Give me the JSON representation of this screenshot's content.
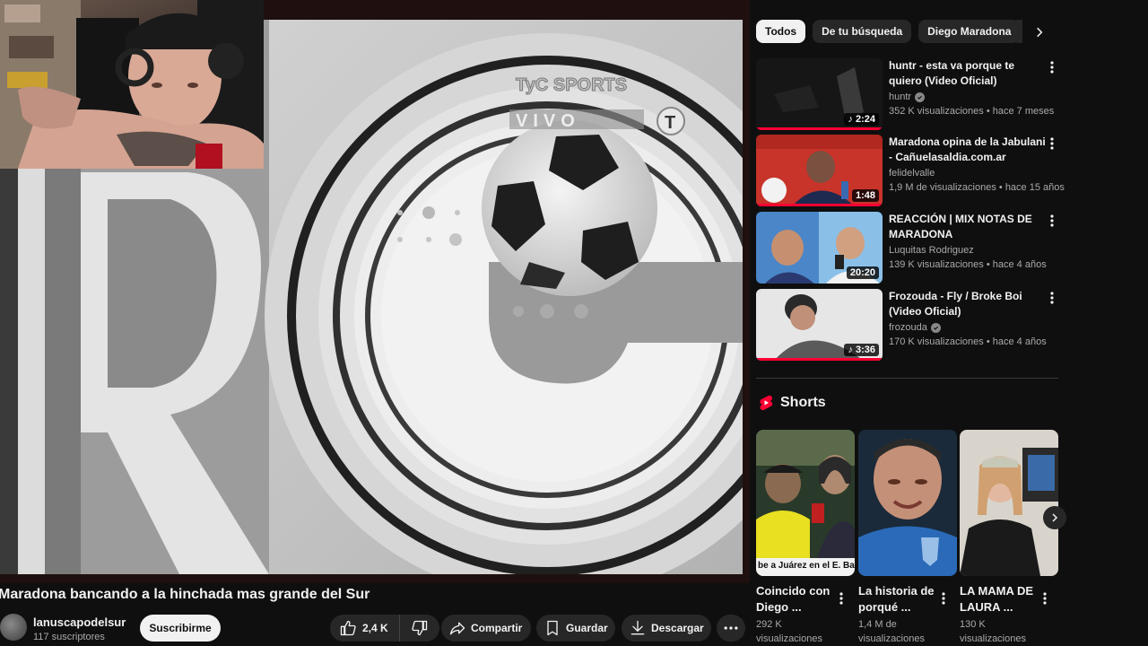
{
  "player": {
    "overlay_brand": "TyC SPORTS",
    "overlay_live": "VIVO",
    "overlay_badge": "T"
  },
  "video": {
    "title": "Maradona bancando a la hinchada mas grande del Sur",
    "channel": "lanuscapodelsur",
    "subscribers": "117 suscriptores",
    "subscribe_label": "Suscribirme",
    "likes": "2,4 K",
    "share_label": "Compartir",
    "save_label": "Guardar",
    "download_label": "Descargar"
  },
  "chips": [
    {
      "label": "Todos",
      "active": true
    },
    {
      "label": "De tu búsqueda",
      "active": false
    },
    {
      "label": "Diego Maradona",
      "active": false
    }
  ],
  "recommendations": [
    {
      "title": "huntr - esta va porque te quiero (Video Oficial)",
      "channel": "huntr",
      "verified": true,
      "views": "352 K visualizaciones",
      "age": "hace 7 meses",
      "duration": "2:24",
      "music": true,
      "progress": 1.0
    },
    {
      "title": "Maradona opina de la Jabulani - Cañuelasaldia.com.ar",
      "channel": "felidelvalle",
      "verified": false,
      "views": "1,9 M de visualizaciones",
      "age": "hace 15 años",
      "duration": "1:48",
      "music": false,
      "progress": 1.0
    },
    {
      "title": "REACCIÓN | MIX NOTAS DE MARADONA",
      "channel": "Luquitas Rodriguez",
      "verified": false,
      "views": "139 K visualizaciones",
      "age": "hace 4 años",
      "duration": "20:20",
      "music": false,
      "progress": 0
    },
    {
      "title": "Frozouda - Fly / Broke Boi (Video Oficial)",
      "channel": "frozouda",
      "verified": true,
      "views": "170 K visualizaciones",
      "age": "hace 4 años",
      "duration": "3:36",
      "music": true,
      "progress": 1.0
    }
  ],
  "shorts": {
    "heading": "Shorts",
    "items": [
      {
        "title": "Coincido con Diego ...",
        "views": "292 K visualizaciones",
        "caption": "be a Juárez en el E. Ba"
      },
      {
        "title": "La historia de porqué ...",
        "views": "1,4 M de visualizaciones"
      },
      {
        "title": "LA MAMA DE LAURA ...",
        "views": "130 K visualizaciones"
      }
    ]
  },
  "colors": {
    "background": "#0f0f0f",
    "accent_red": "#ff0033",
    "chip_bg": "#272727",
    "text_secondary": "#aaaaaa"
  }
}
